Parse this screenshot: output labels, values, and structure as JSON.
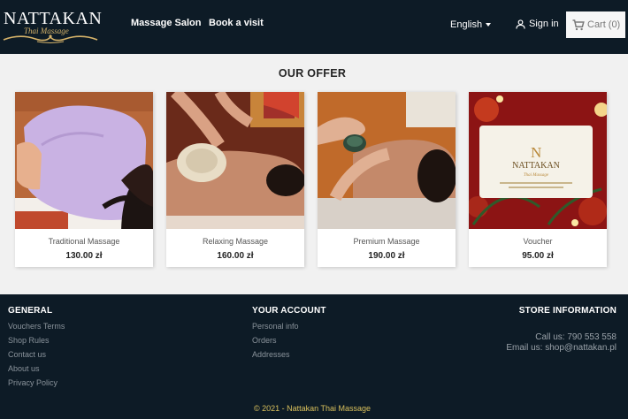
{
  "header": {
    "logo_text": "NATTAKAN",
    "logo_subtext": "Thai Massage",
    "nav": [
      "Massage Salon",
      "Book a visit"
    ],
    "language": "English",
    "sign_in": "Sign in",
    "cart_label": "Cart",
    "cart_count": "(0)"
  },
  "main": {
    "title": "OUR OFFER",
    "products": [
      {
        "name": "Traditional Massage",
        "price": "130.00 zł"
      },
      {
        "name": "Relaxing Massage",
        "price": "160.00 zł"
      },
      {
        "name": "Premium Massage",
        "price": "190.00 zł"
      },
      {
        "name": "Voucher",
        "price": "95.00 zł"
      }
    ]
  },
  "footer": {
    "general": {
      "title": "GENERAL",
      "links": [
        "Vouchers Terms",
        "Shop Rules",
        "Contact us",
        "About us",
        "Privacy Policy"
      ]
    },
    "account": {
      "title": "YOUR ACCOUNT",
      "links": [
        "Personal info",
        "Orders",
        "Addresses"
      ]
    },
    "store": {
      "title": "STORE INFORMATION",
      "phone_label": "Call us:",
      "phone": "790 553 558",
      "email_label": "Email us:",
      "email": "shop@nattakan.pl"
    },
    "copyright": "© 2021 - Nattakan Thai Massage"
  },
  "colors": {
    "header_bg": "#0d1b26",
    "gold": "#d7b46a",
    "copyright": "#d9c05c"
  }
}
